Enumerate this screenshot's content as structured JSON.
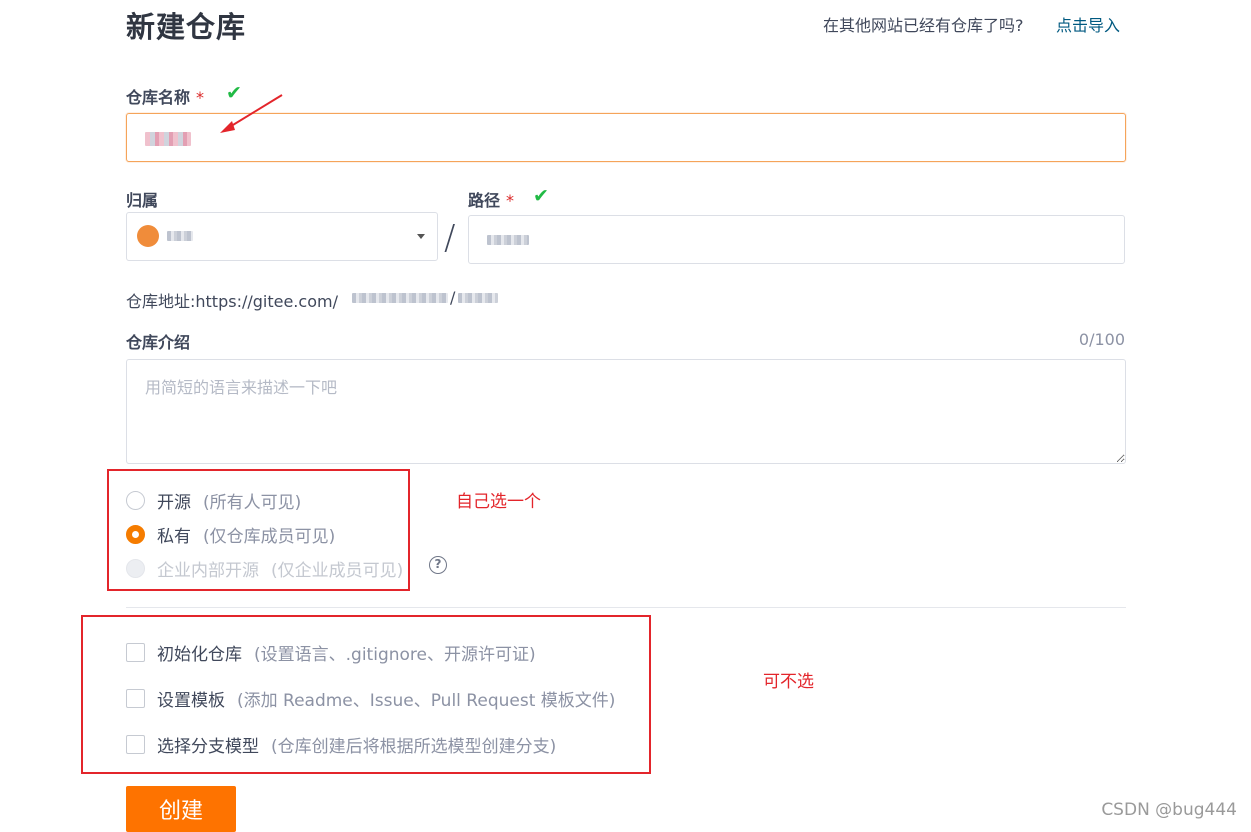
{
  "header": {
    "title": "新建仓库",
    "import_question": "在其他网站已经有仓库了吗?",
    "import_link": "点击导入"
  },
  "repo_name": {
    "label": "仓库名称",
    "required_mark": "*",
    "check_icon": "check-icon"
  },
  "owner": {
    "label": "归属"
  },
  "path": {
    "label": "路径",
    "required_mark": "*"
  },
  "separator": "/",
  "address": {
    "prefix": "仓库地址:https://gitee.com/"
  },
  "intro": {
    "label": "仓库介绍",
    "counter": "0/100",
    "placeholder": "用简短的语言来描述一下吧"
  },
  "visibility": {
    "options": [
      {
        "label": "开源",
        "hint": "(所有人可见)",
        "selected": false,
        "disabled": false
      },
      {
        "label": "私有",
        "hint": "(仅仓库成员可见)",
        "selected": true,
        "disabled": false
      },
      {
        "label": "企业内部开源",
        "hint": "(仅企业成员可见)",
        "selected": false,
        "disabled": true
      }
    ],
    "help_icon": "?"
  },
  "init_options": [
    {
      "label": "初始化仓库",
      "hint": "(设置语言、.gitignore、开源许可证)",
      "checked": false
    },
    {
      "label": "设置模板",
      "hint": "(添加 Readme、Issue、Pull Request 模板文件)",
      "checked": false
    },
    {
      "label": "选择分支模型",
      "hint": "(仓库创建后将根据所选模型创建分支)",
      "checked": false
    }
  ],
  "annotations": {
    "visibility_note": "自己选一个",
    "init_note": "可不选"
  },
  "create_button": "创建",
  "watermark": "CSDN @bug444",
  "colors": {
    "accent": "#fe7300",
    "link": "#005980",
    "annotation_red": "#e3252b",
    "check_green": "#21ba45"
  }
}
